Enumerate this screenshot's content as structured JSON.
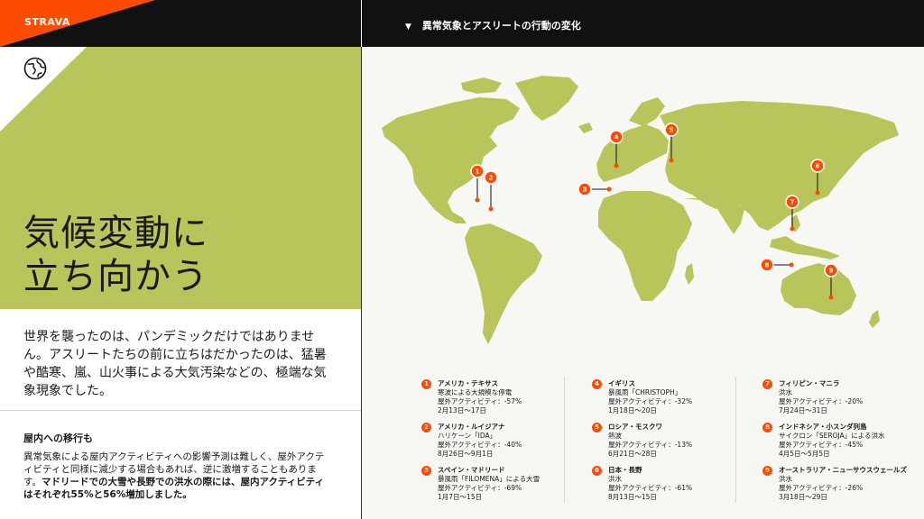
{
  "brand": {
    "logo": "STRAVA",
    "accent": "#fc4c02",
    "green": "#b9c45a"
  },
  "header": {
    "map_title": "異常気象とアスリートの行動の変化",
    "triangle": "▼"
  },
  "left": {
    "title_line1": "気候変動に",
    "title_line2": "立ち向かう",
    "intro": "世界を襲ったのは、パンデミックだけではありません。アスリートたちの前に立ちはだかったのは、猛暑や酷寒、嵐、山火事による大気汚染などの、極端な気象現象でした。",
    "sub_heading": "屋内への移行も",
    "sub_body": "異常気象による屋内アクティビティへの影響予測は難しく、屋外アクティビティと同様に減少する場合もあれば、逆に激増することもあります。",
    "sub_body_bold": "マドリードでの大雪や長野での洪水の際には、屋内アクティビティはそれぞれ55%と56%増加しました。"
  },
  "markers": [
    "1",
    "2",
    "3",
    "4",
    "5",
    "6",
    "7",
    "8",
    "9"
  ],
  "legend": [
    {
      "num": "1",
      "name": "アメリカ・テキサス",
      "event": "寒波による大規模な停電",
      "activity": "屋外アクティビティ：-57%",
      "dates": "2月13日〜17日"
    },
    {
      "num": "2",
      "name": "アメリカ・ルイジアナ",
      "event": "ハリケーン「IDA」",
      "activity": "屋外アクティビティ：-40%",
      "dates": "8月26日〜9月1日"
    },
    {
      "num": "3",
      "name": "スペイン・マドリード",
      "event": "暴風雨「FILOMENA」による大雪",
      "activity": "屋外アクティビティ：-69%",
      "dates": "1月7日〜15日"
    },
    {
      "num": "4",
      "name": "イギリス",
      "event": "暴風雨「CHRISTOPH」",
      "activity": "屋外アクティビティ：-32%",
      "dates": "1月18日〜20日"
    },
    {
      "num": "5",
      "name": "ロシア・モスクワ",
      "event": "熱波",
      "activity": "屋外アクティビティ：-13%",
      "dates": "6月21日〜28日"
    },
    {
      "num": "6",
      "name": "日本・長野",
      "event": "洪水",
      "activity": "屋外アクティビティ：-61%",
      "dates": "8月13日〜15日"
    },
    {
      "num": "7",
      "name": "フィリピン・マニラ",
      "event": "洪水",
      "activity": "屋外アクティビティ：-20%",
      "dates": "7月24日〜31日"
    },
    {
      "num": "8",
      "name": "インドネシア・小スンダ列島",
      "event": "サイクロン「SEROJA」による洪水",
      "activity": "屋外アクティビティ：-45%",
      "dates": "4月5日〜5月5日"
    },
    {
      "num": "9",
      "name": "オーストラリア・ニューサウスウェールズ",
      "event": "洪水",
      "activity": "屋外アクティビティ：-26%",
      "dates": "3月18日〜29日"
    }
  ]
}
